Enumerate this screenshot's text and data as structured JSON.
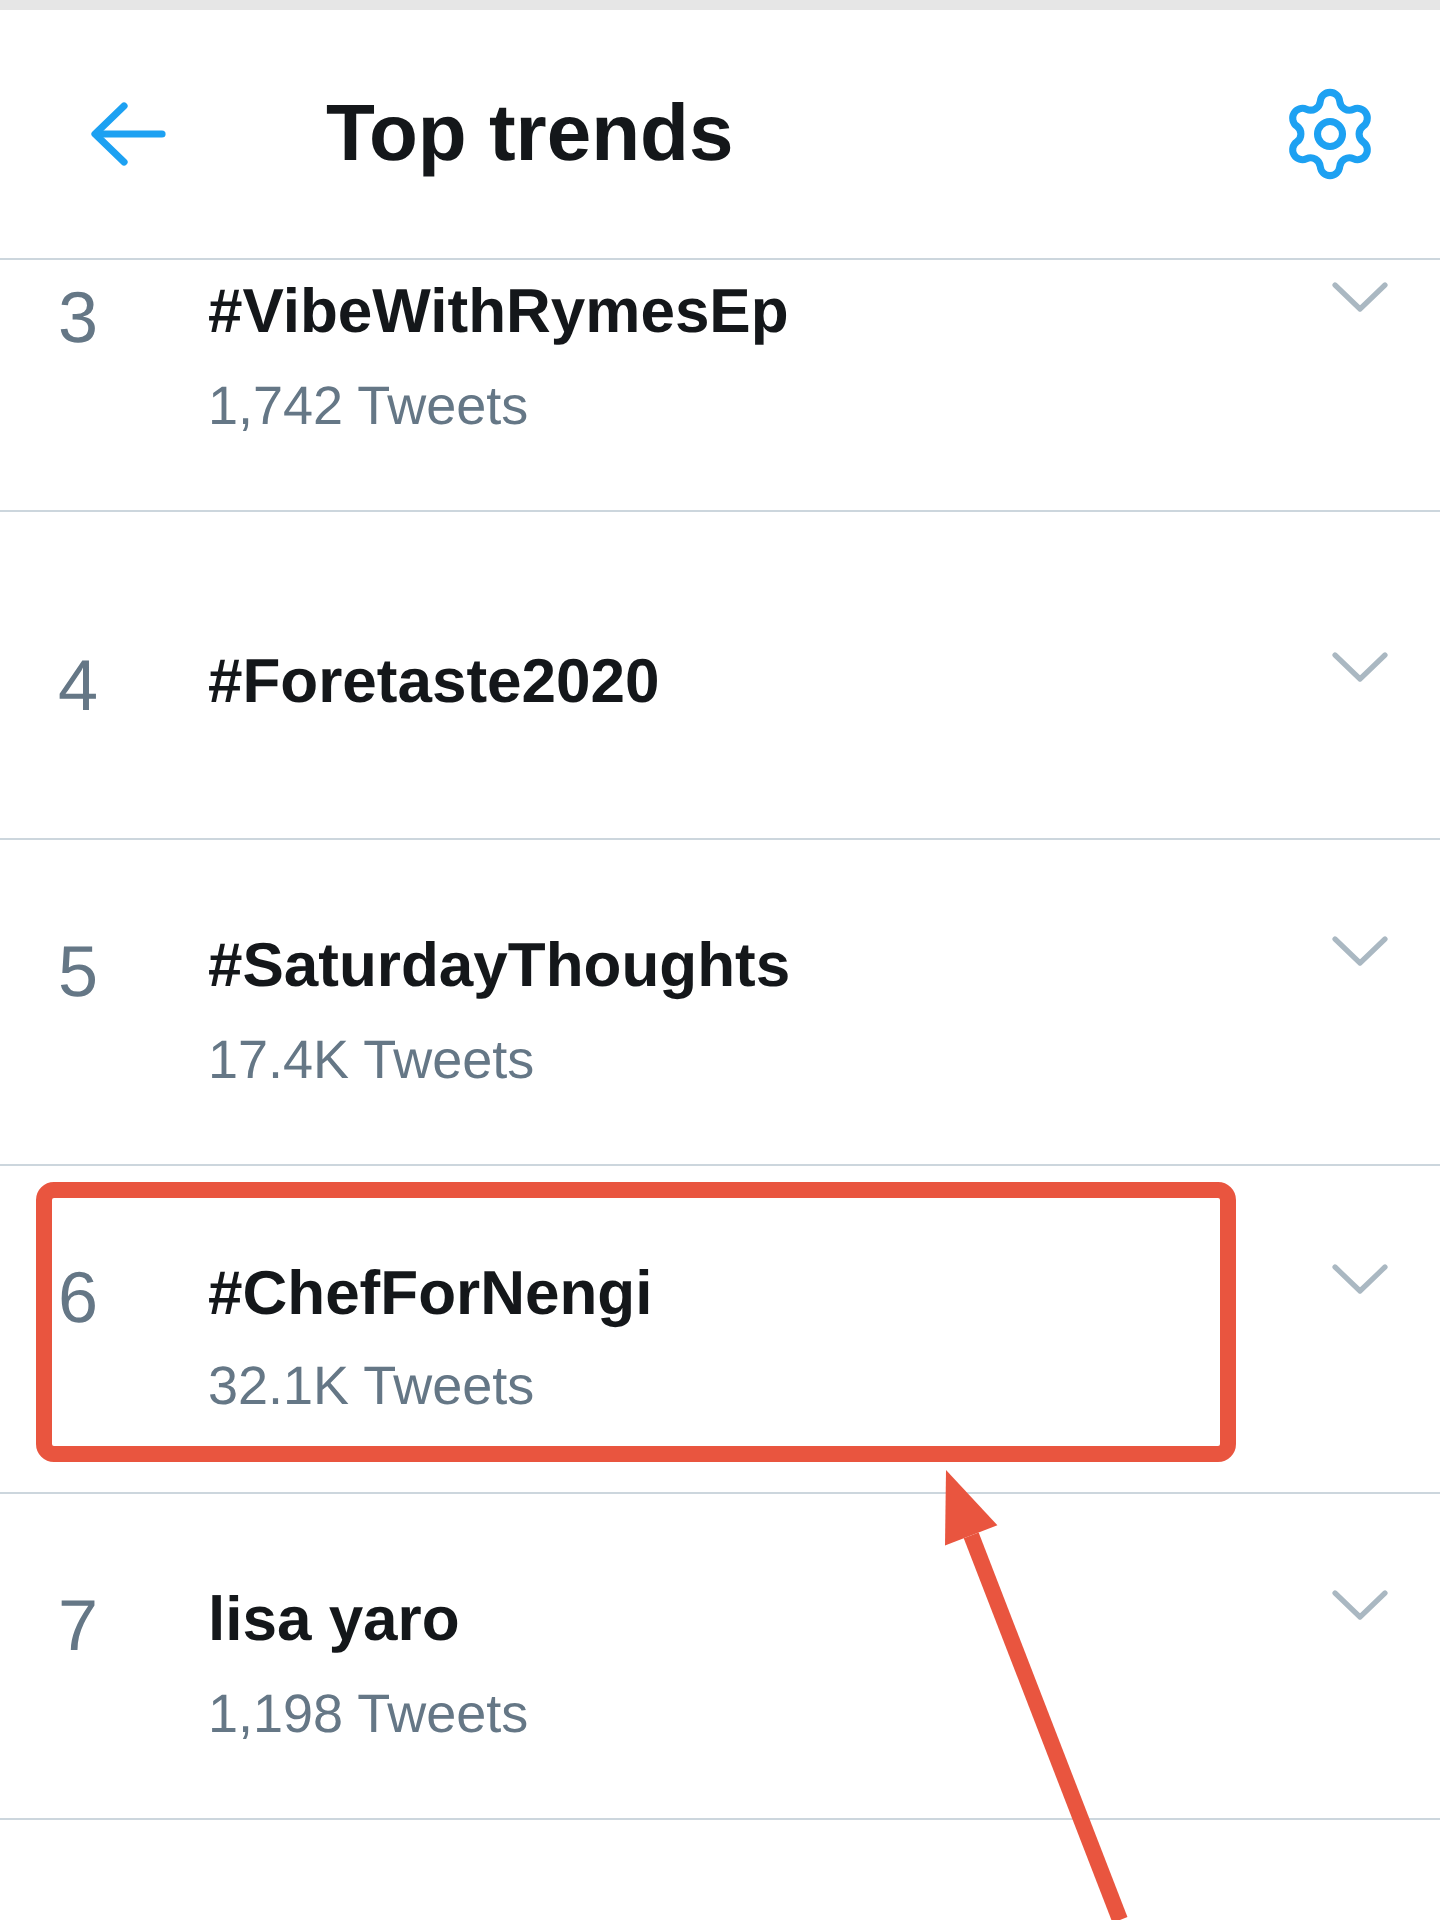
{
  "header": {
    "title": "Top trends"
  },
  "trends": [
    {
      "rank": "3",
      "name": "#VibeWithRymesEp",
      "tweet_count": "1,742 Tweets",
      "highlighted": false
    },
    {
      "rank": "4",
      "name": "#Foretaste2020",
      "highlighted": false
    },
    {
      "rank": "5",
      "name": "#SaturdayThoughts",
      "tweet_count": "17.4K Tweets",
      "highlighted": false
    },
    {
      "rank": "6",
      "name": "#ChefForNengi",
      "tweet_count": "32.1K Tweets",
      "highlighted": true
    },
    {
      "rank": "7",
      "name": "lisa yaro",
      "tweet_count": "1,198 Tweets",
      "highlighted": false
    }
  ],
  "annotation": {
    "arrow": true
  }
}
